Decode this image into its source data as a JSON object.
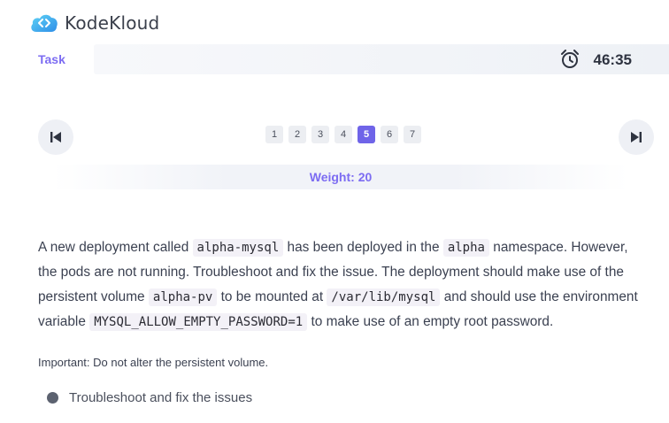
{
  "brand": {
    "name": "KodeKloud",
    "logo_icon": "kodekloud-logo-icon"
  },
  "header": {
    "task_label": "Task",
    "timer": "46:35",
    "timer_icon": "alarm-clock-icon"
  },
  "navigation": {
    "prev_icon": "skip-previous-icon",
    "next_icon": "skip-next-icon",
    "pages": [
      "1",
      "2",
      "3",
      "4",
      "5",
      "6",
      "7"
    ],
    "current_page": "5"
  },
  "weight": "Weight: 20",
  "task": {
    "segments": [
      "A new deployment called ",
      "alpha-mysql",
      " has been deployed in the ",
      "alpha",
      " namespace. However, the pods are not running. Troubleshoot and fix the issue. The deployment should make use of the persistent volume ",
      "alpha-pv",
      " to be mounted at ",
      "/var/lib/mysql",
      " and should use the environment variable ",
      "MYSQL_ALLOW_EMPTY_PASSWORD=1",
      " to make use of an empty root password."
    ],
    "important": "Important: Do not alter the persistent volume.",
    "checklist": [
      "Troubleshoot and fix the issues"
    ]
  },
  "colors": {
    "accent": "#7c6cf2",
    "active_page": "#6f64e8",
    "logo_blue": "#2fb0e8"
  }
}
